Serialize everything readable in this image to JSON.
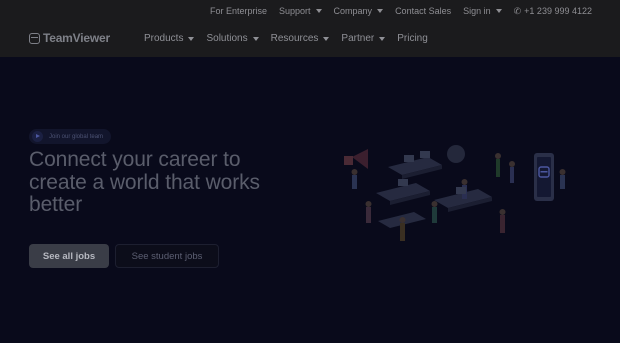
{
  "topbar": {
    "items": [
      {
        "label": "For Enterprise",
        "dropdown": false
      },
      {
        "label": "Support",
        "dropdown": true
      },
      {
        "label": "Company",
        "dropdown": true
      },
      {
        "label": "Contact Sales",
        "dropdown": false
      },
      {
        "label": "Sign in",
        "dropdown": true
      }
    ],
    "phone": "+1 239 999 4122",
    "phone_icon": "phone-icon"
  },
  "logo": {
    "text": "TeamViewer"
  },
  "nav": {
    "items": [
      {
        "label": "Products",
        "dropdown": true
      },
      {
        "label": "Solutions",
        "dropdown": true
      },
      {
        "label": "Resources",
        "dropdown": true
      },
      {
        "label": "Partner",
        "dropdown": true
      },
      {
        "label": "Pricing",
        "dropdown": false
      }
    ]
  },
  "hero": {
    "badge": "Join our global team",
    "headline": "Connect your career to create a world that works better",
    "primary_button": "See all jobs",
    "secondary_button": "See student jobs"
  },
  "colors": {
    "background": "#090a1b",
    "header": "#1b1b1d",
    "accent": "#4c57a0"
  }
}
